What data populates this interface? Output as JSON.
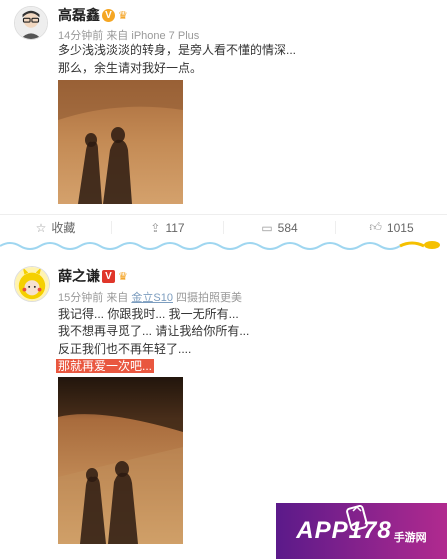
{
  "post1": {
    "username": "高磊鑫",
    "badge": "V",
    "meta_time": "14分钟前",
    "meta_from": "来自",
    "meta_device": "iPhone 7 Plus",
    "lines": [
      "多少浅浅淡淡的转身，是旁人看不懂的情深...",
      "那么，余生请对我好一点。"
    ],
    "actions": {
      "favorite": "收藏",
      "repost": "117",
      "comment": "584",
      "like": "1015"
    }
  },
  "post2": {
    "username": "薛之谦",
    "badge": "V",
    "meta_time": "15分钟前",
    "meta_from": "来自",
    "meta_device": "金立S10",
    "meta_tail": "四摄拍照更美",
    "lines": [
      "我记得... 你跟我时... 我一无所有...",
      "我不想再寻觅了... 请让我给你所有...",
      "反正我们也不再年轻了....",
      "那就再爱一次吧..."
    ]
  },
  "watermark": {
    "brand": "APP178",
    "sub": "手游网"
  },
  "colors": {
    "accent_orange": "#f5a623",
    "highlight_red": "#e9573f",
    "link_blue": "#7c9dbf",
    "watermark_purple": "#7a2290"
  }
}
